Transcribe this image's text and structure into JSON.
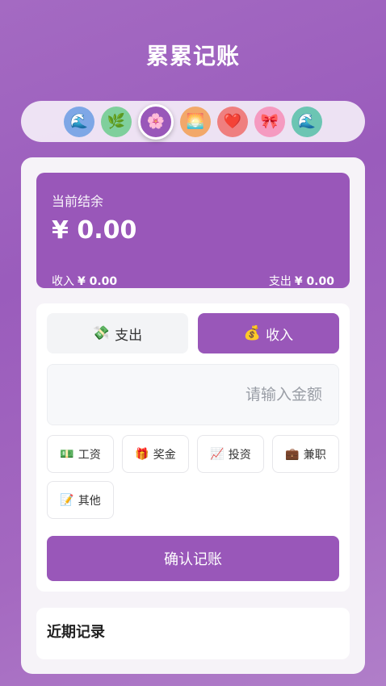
{
  "app": {
    "title": "累累记账"
  },
  "themes": [
    {
      "name": "ocean",
      "glyph": "🌊",
      "color": "#7ea7e6",
      "active": false
    },
    {
      "name": "leaf",
      "glyph": "🌿",
      "color": "#7fcf9c",
      "active": false
    },
    {
      "name": "sakura",
      "glyph": "🌸",
      "color": "#9957b9",
      "active": true
    },
    {
      "name": "sunset",
      "glyph": "🌅",
      "color": "#f2a86a",
      "active": false
    },
    {
      "name": "heart",
      "glyph": "❤️",
      "color": "#ef7f7f",
      "active": false
    },
    {
      "name": "ribbon",
      "glyph": "🎀",
      "color": "#f59ac0",
      "active": false
    },
    {
      "name": "wave",
      "glyph": "🌊",
      "color": "#6cc5b3",
      "active": false
    }
  ],
  "balance": {
    "label": "当前结余",
    "amount": "¥ 0.00",
    "income_label": "收入",
    "income_value": "¥ 0.00",
    "expense_label": "支出",
    "expense_value": "¥ 0.00"
  },
  "tabs": {
    "expense": {
      "emoji": "💸",
      "label": "支出"
    },
    "income": {
      "emoji": "💰",
      "label": "收入",
      "selected": true
    }
  },
  "amount_input": {
    "placeholder": "请输入金额",
    "value": ""
  },
  "categories": [
    {
      "emoji": "💵",
      "label": "工资"
    },
    {
      "emoji": "🎁",
      "label": "奖金"
    },
    {
      "emoji": "📈",
      "label": "投资"
    },
    {
      "emoji": "💼",
      "label": "兼职"
    },
    {
      "emoji": "📝",
      "label": "其他"
    }
  ],
  "confirm_label": "确认记账",
  "recent": {
    "title": "近期记录"
  },
  "colors": {
    "accent": "#9957b9",
    "background": "#a46ac2"
  }
}
